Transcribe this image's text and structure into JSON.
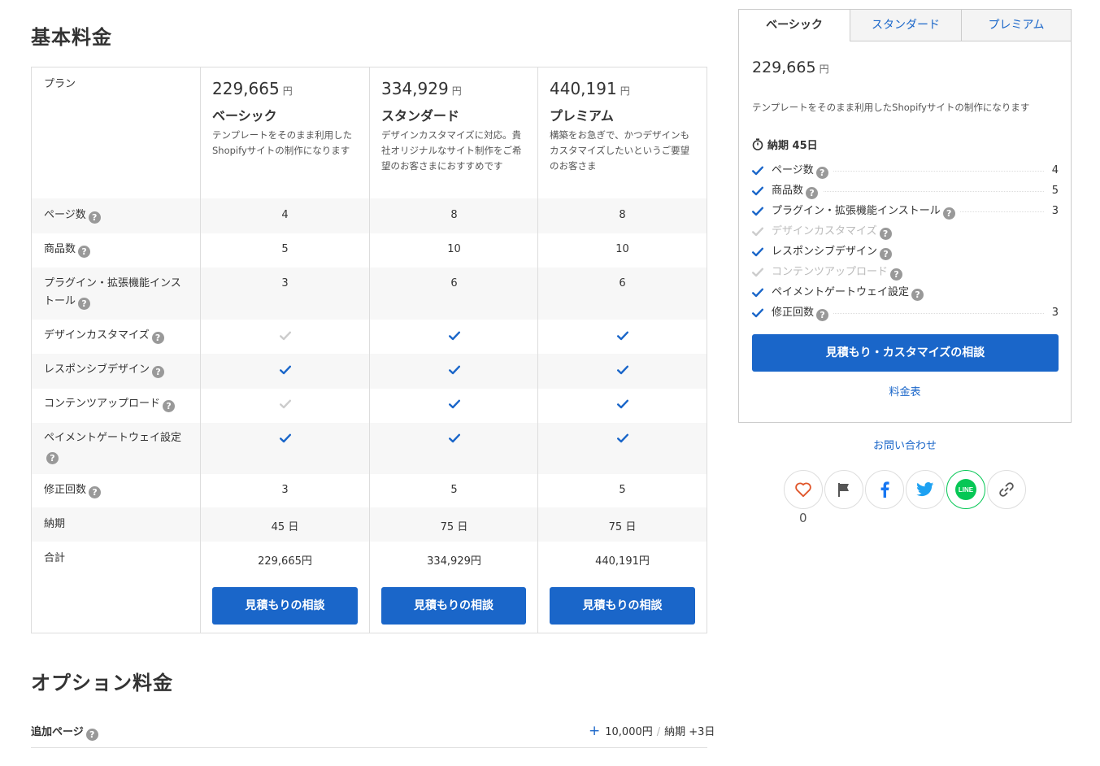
{
  "sections": {
    "basic_title": "基本料金",
    "option_title": "オプション料金"
  },
  "table": {
    "plan_label": "プラン",
    "plans": [
      {
        "price": "229,665",
        "yen": "円",
        "name": "ベーシック",
        "desc": "テンプレートをそのまま利用したShopifyサイトの制作になります",
        "button": "見積もりの相談"
      },
      {
        "price": "334,929",
        "yen": "円",
        "name": "スタンダード",
        "desc": "デザインカスタマイズに対応。貴社オリジナルなサイト制作をご希望のお客さまにおすすめです",
        "button": "見積もりの相談"
      },
      {
        "price": "440,191",
        "yen": "円",
        "name": "プレミアム",
        "desc": "構築をお急ぎで、かつデザインもカスタマイズしたいというご要望のお客さま",
        "button": "見積もりの相談"
      }
    ],
    "rows": [
      {
        "label": "ページ数",
        "help": true,
        "type": "text",
        "values": [
          "4",
          "8",
          "8"
        ]
      },
      {
        "label": "商品数",
        "help": true,
        "type": "text",
        "values": [
          "5",
          "10",
          "10"
        ]
      },
      {
        "label": "プラグイン・拡張機能インストール",
        "help": true,
        "type": "text",
        "values": [
          "3",
          "6",
          "6"
        ]
      },
      {
        "label": "デザインカスタマイズ",
        "help": true,
        "type": "check",
        "values": [
          false,
          true,
          true
        ]
      },
      {
        "label": "レスポンシブデザイン",
        "help": true,
        "type": "check",
        "values": [
          true,
          true,
          true
        ]
      },
      {
        "label": "コンテンツアップロード",
        "help": true,
        "type": "check",
        "values": [
          false,
          true,
          true
        ]
      },
      {
        "label": "ペイメントゲートウェイ設定",
        "help": true,
        "type": "check",
        "values": [
          true,
          true,
          true
        ]
      },
      {
        "label": "修正回数",
        "help": true,
        "type": "text",
        "values": [
          "3",
          "5",
          "5"
        ]
      },
      {
        "label": "納期",
        "help": false,
        "type": "text",
        "values": [
          "45 日",
          "75 日",
          "75 日"
        ]
      },
      {
        "label": "合計",
        "help": false,
        "type": "text",
        "values": [
          "229,665円",
          "334,929円",
          "440,191円"
        ]
      }
    ]
  },
  "option": {
    "label": "追加ページ",
    "plus": "+",
    "price": "10,000円",
    "sep": "/",
    "delivery": "納期 +3日"
  },
  "sidebar": {
    "tabs": [
      "ベーシック",
      "スタンダード",
      "プレミアム"
    ],
    "active_tab": 0,
    "price": "229,665",
    "yen": "円",
    "desc": "テンプレートをそのまま利用したShopifyサイトの制作になります",
    "delivery": "納期 45日",
    "features": [
      {
        "label": "ページ数",
        "on": true,
        "value": "4"
      },
      {
        "label": "商品数",
        "on": true,
        "value": "5"
      },
      {
        "label": "プラグイン・拡張機能インストール",
        "on": true,
        "value": "3"
      },
      {
        "label": "デザインカスタマイズ",
        "on": false,
        "value": ""
      },
      {
        "label": "レスポンシブデザイン",
        "on": true,
        "value": ""
      },
      {
        "label": "コンテンツアップロード",
        "on": false,
        "value": ""
      },
      {
        "label": "ペイメントゲートウェイ設定",
        "on": true,
        "value": ""
      },
      {
        "label": "修正回数",
        "on": true,
        "value": "3"
      }
    ],
    "button": "見積もり・カスタマイズの相談",
    "price_table_link": "料金表"
  },
  "contact_link": "お問い合わせ",
  "social": {
    "like_count": "0",
    "buttons": [
      "heart-icon",
      "flag-icon",
      "facebook-icon",
      "twitter-icon",
      "line-icon",
      "link-icon"
    ],
    "line_text": "LINE"
  },
  "colors": {
    "accent": "#1a66c9",
    "check_on": "#1a66c9",
    "check_off": "#cccccc",
    "heart": "#e0562b",
    "line": "#06c755",
    "twitter": "#1da1f2",
    "facebook": "#1877f2"
  }
}
